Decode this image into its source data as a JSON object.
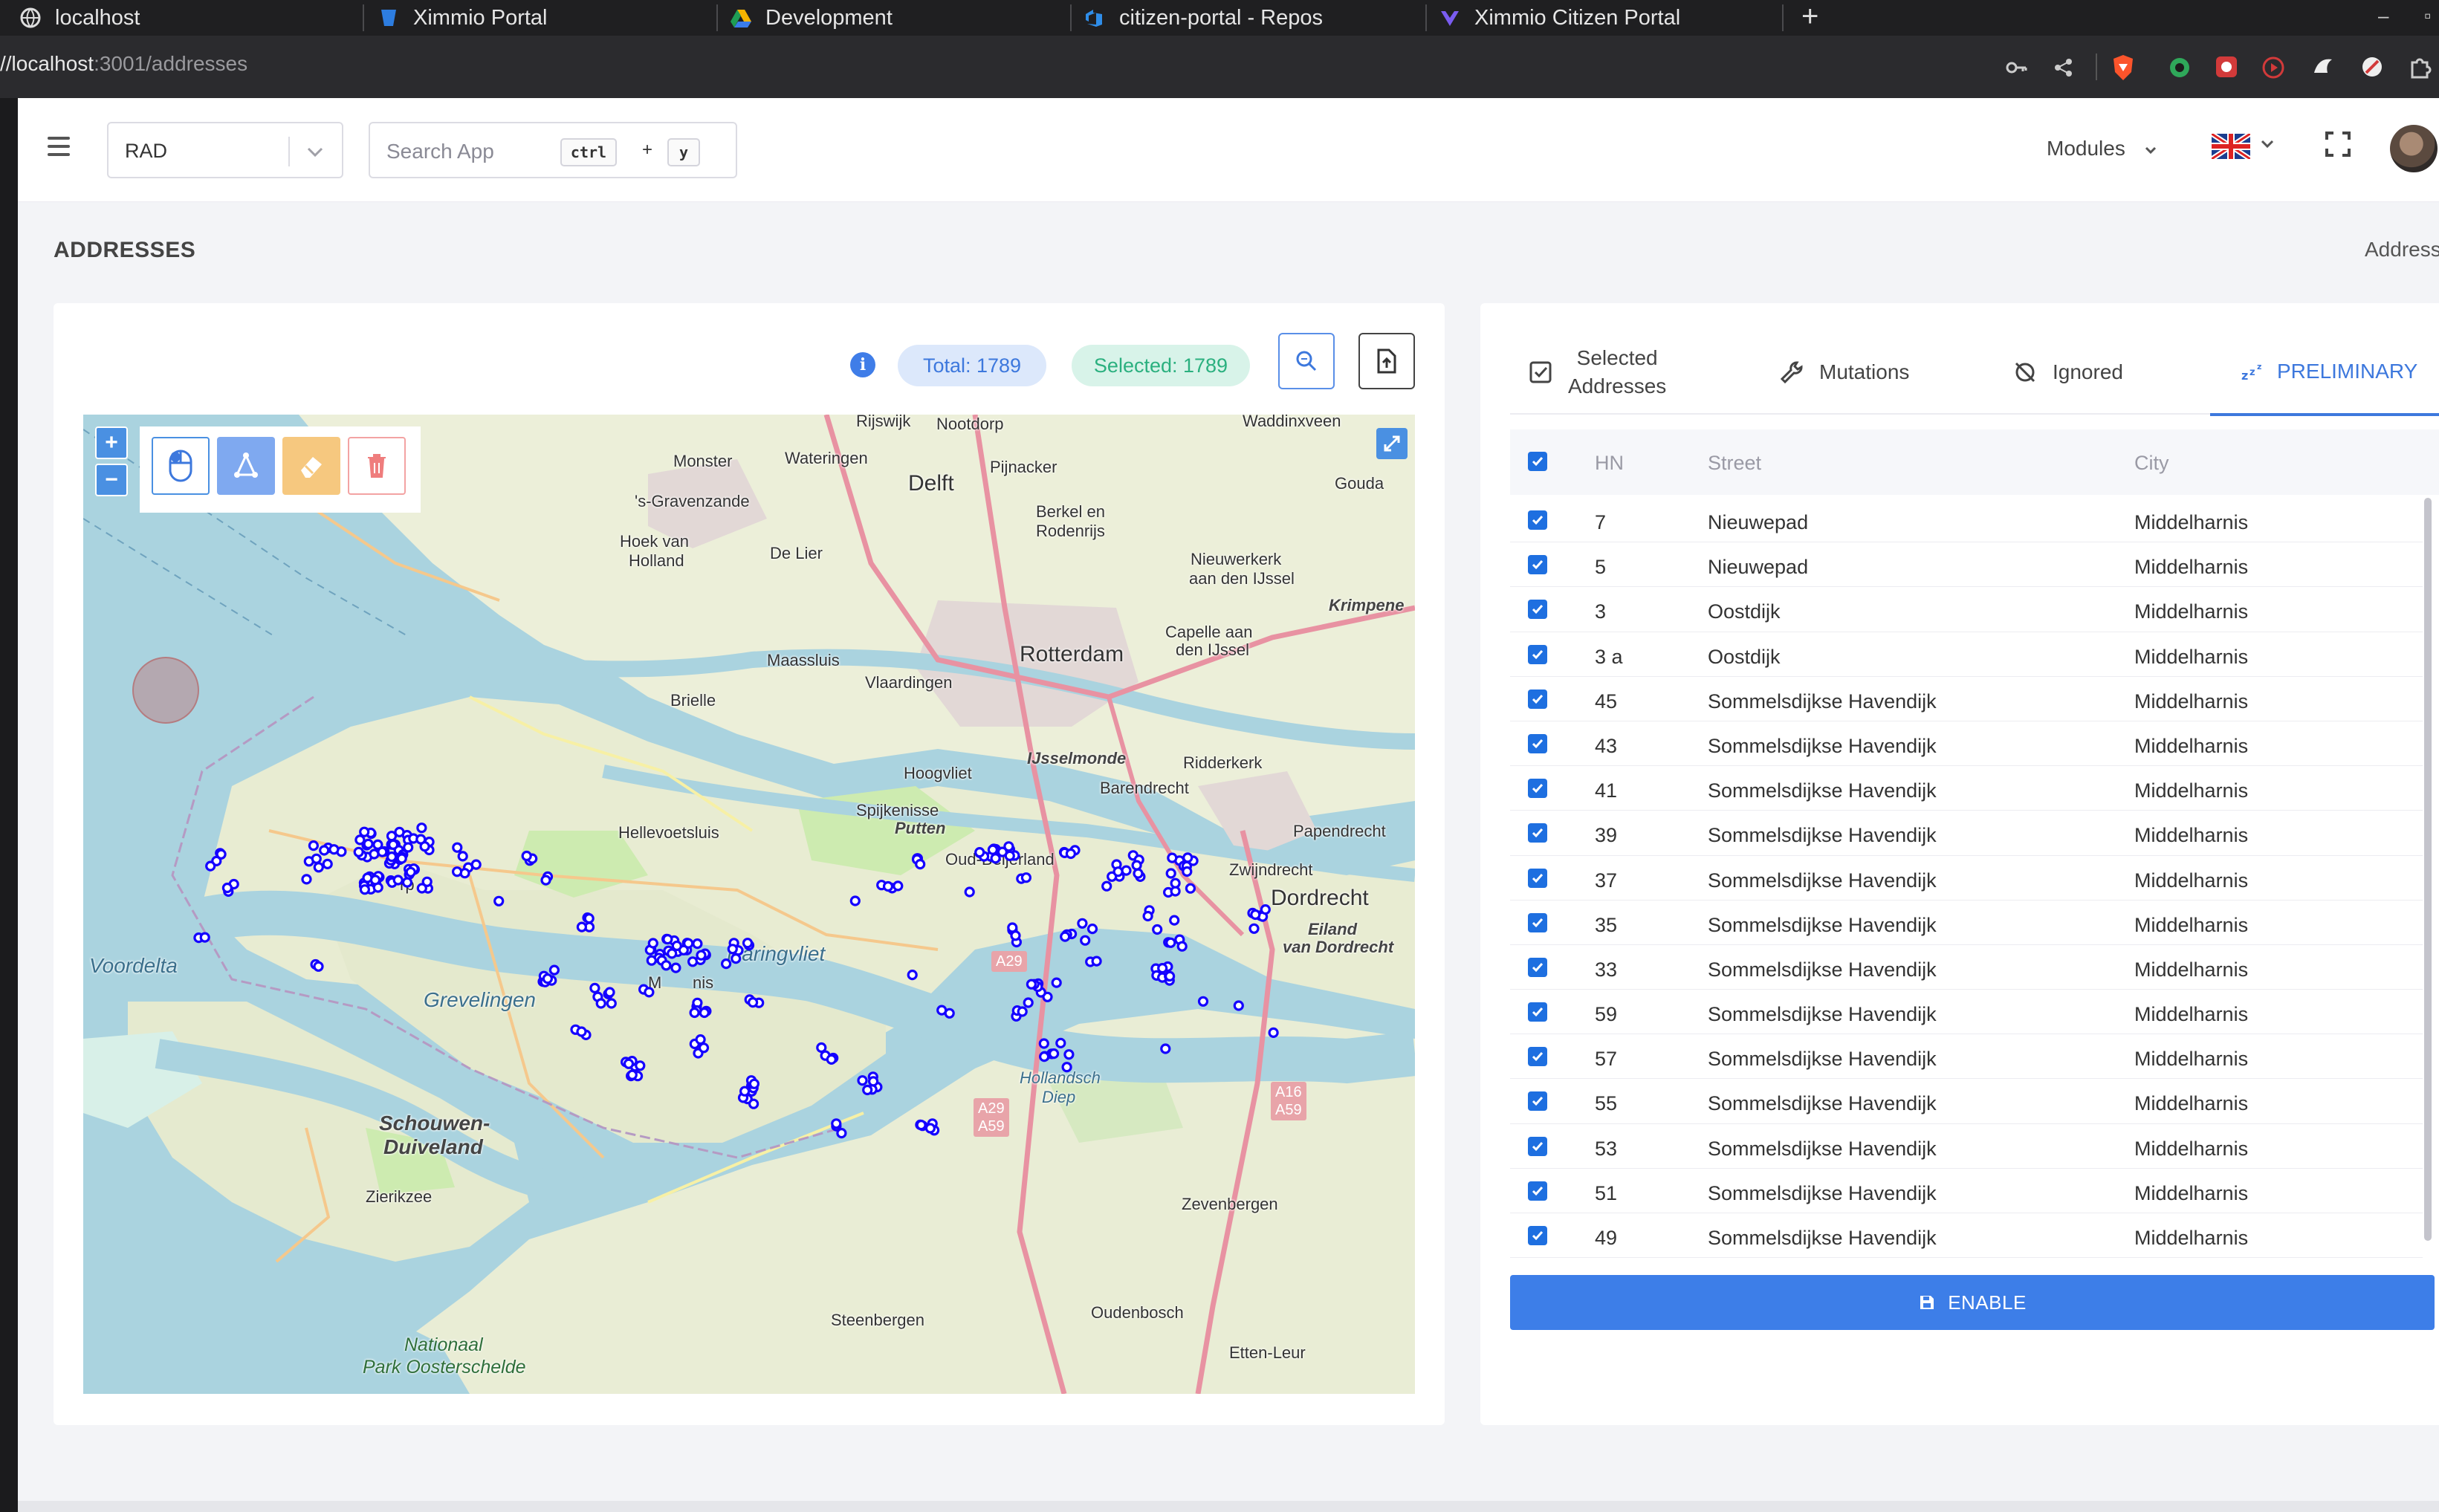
{
  "browser": {
    "tabs": [
      {
        "title": "localhost",
        "icon": "globe-icon"
      },
      {
        "title": "Ximmio Portal",
        "icon": "bitbucket-icon"
      },
      {
        "title": "Development",
        "icon": "drive-icon"
      },
      {
        "title": "citizen-portal - Repos",
        "icon": "azure-devops-icon"
      },
      {
        "title": "Ximmio Citizen Portal",
        "icon": "heart-icon"
      }
    ],
    "new_tab": "+",
    "url_prefix": "//localhost",
    "url_rest": ":3001/addresses"
  },
  "header": {
    "select_value": "RAD",
    "search_placeholder": "Search App",
    "shortcut_key1": "ctrl",
    "shortcut_plus": "+",
    "shortcut_key2": "y",
    "modules_label": "Modules",
    "language": "en-GB"
  },
  "page": {
    "title": "ADDRESSES",
    "breadcrumb": "Address"
  },
  "map_panel": {
    "total_label": "Total: 1789",
    "selected_label": "Selected: 1789",
    "zoom_in": "+",
    "zoom_out": "−",
    "labels": {
      "rijswijk": "Rijswijk",
      "nootdorp": "Nootdorp",
      "waddinxveen": "Waddinxveen",
      "monster": "Monster",
      "wateringen": "Wateringen",
      "delft": "Delft",
      "pijnacker": "Pijnacker",
      "gouda": "Gouda",
      "sgravenzande": "'s-Gravenzande",
      "berkel": "Berkel en",
      "rodenrijs": "Rodenrijs",
      "hoekvan": "Hoek van",
      "holland": "Holland",
      "delier": "De Lier",
      "nieuwerkerk": "Nieuwerkerk",
      "aandenijssel": "aan den IJssel",
      "krimpen": "Krimpene",
      "maassluis": "Maassluis",
      "rotterdam": "Rotterdam",
      "capelle": "Capelle aan",
      "denijssel": "den IJssel",
      "vlaardingen": "Vlaardingen",
      "brielle": "Brielle",
      "ijsselmonde": "IJsselmonde",
      "hoogvliet": "Hoogvliet",
      "ridderkerk": "Ridderkerk",
      "barendrecht": "Barendrecht",
      "spijkenisse": "Spijkenisse",
      "putten": "Putten",
      "hellevoetsluis": "Hellevoetsluis",
      "papendrecht": "Papendrecht",
      "zwijndrecht": "Zwijndrecht",
      "oudbeijerland": "Oud-Beijerland",
      "dordrecht": "Dordrecht",
      "eiland": "Eiland",
      "vandordrecht": "van Dordrecht",
      "voordelta": "Voordelta",
      "haringvliet": "Haringvliet",
      "grevelingen": "Grevelingen",
      "hollandsch": "Hollandsch",
      "diep": "Diep",
      "schouwen": "Schouwen-",
      "duiveland": "Duiveland",
      "zierikzee": "Zierikzee",
      "zevenbergen": "Zevenbergen",
      "steenbergen": "Steenbergen",
      "oudenbosch": "Oudenbosch",
      "nationaal": "Nationaal",
      "oosterschelde": "Park Oosterschelde",
      "ettenleur": "Etten-Leur",
      "rp": "rp",
      "mdlh": "M",
      "nis": "nis",
      "a29": "A29",
      "a29b": "A29",
      "a59": "A59",
      "a16": "A16",
      "a59b": "A59"
    }
  },
  "table_panel": {
    "tabs": [
      {
        "label_line1": "Selected",
        "label_line2": "Addresses",
        "icon": "checkbox-icon"
      },
      {
        "label": "Mutations",
        "icon": "wrench-icon"
      },
      {
        "label": "Ignored",
        "icon": "ignore-icon"
      },
      {
        "label": "PRELIMINARY",
        "icon": "sleep-icon",
        "active": true
      }
    ],
    "columns": {
      "hn": "HN",
      "street": "Street",
      "city": "City"
    },
    "rows": [
      {
        "hn": "7",
        "street": "Nieuwepad",
        "city": "Middelharnis"
      },
      {
        "hn": "5",
        "street": "Nieuwepad",
        "city": "Middelharnis"
      },
      {
        "hn": "3",
        "street": "Oostdijk",
        "city": "Middelharnis"
      },
      {
        "hn": "3 a",
        "street": "Oostdijk",
        "city": "Middelharnis"
      },
      {
        "hn": "45",
        "street": "Sommelsdijkse Havendijk",
        "city": "Middelharnis"
      },
      {
        "hn": "43",
        "street": "Sommelsdijkse Havendijk",
        "city": "Middelharnis"
      },
      {
        "hn": "41",
        "street": "Sommelsdijkse Havendijk",
        "city": "Middelharnis"
      },
      {
        "hn": "39",
        "street": "Sommelsdijkse Havendijk",
        "city": "Middelharnis"
      },
      {
        "hn": "37",
        "street": "Sommelsdijkse Havendijk",
        "city": "Middelharnis"
      },
      {
        "hn": "35",
        "street": "Sommelsdijkse Havendijk",
        "city": "Middelharnis"
      },
      {
        "hn": "33",
        "street": "Sommelsdijkse Havendijk",
        "city": "Middelharnis"
      },
      {
        "hn": "59",
        "street": "Sommelsdijkse Havendijk",
        "city": "Middelharnis"
      },
      {
        "hn": "57",
        "street": "Sommelsdijkse Havendijk",
        "city": "Middelharnis"
      },
      {
        "hn": "55",
        "street": "Sommelsdijkse Havendijk",
        "city": "Middelharnis"
      },
      {
        "hn": "53",
        "street": "Sommelsdijkse Havendijk",
        "city": "Middelharnis"
      },
      {
        "hn": "51",
        "street": "Sommelsdijkse Havendijk",
        "city": "Middelharnis"
      },
      {
        "hn": "49",
        "street": "Sommelsdijkse Havendijk",
        "city": "Middelharnis"
      }
    ],
    "enable_label": "ENABLE"
  },
  "colors": {
    "accent": "#3d7ee8",
    "marker": "#1400ff",
    "total_pill": "#dce8fb",
    "selected_pill": "#d8f3e9"
  }
}
